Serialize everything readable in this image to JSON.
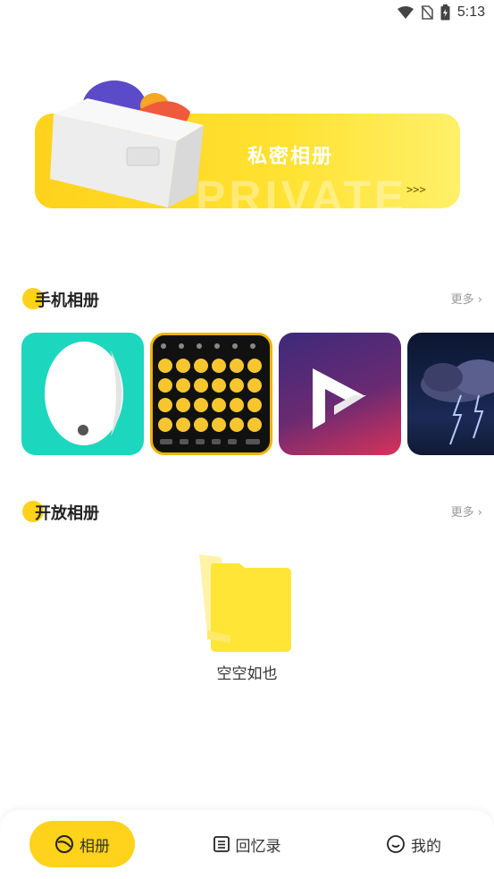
{
  "status_bar": {
    "time": "5:13"
  },
  "banner": {
    "title": "私密相册",
    "watermark": "PRIVATE",
    "arrows": ">>>"
  },
  "phone_albums": {
    "title": "手机相册",
    "more": "更多"
  },
  "open_albums": {
    "title": "开放相册",
    "more": "更多",
    "empty_text": "空空如也"
  },
  "bottom_nav": {
    "items": [
      {
        "label": "相册",
        "icon": "album-icon",
        "active": true
      },
      {
        "label": "回忆录",
        "icon": "list-icon",
        "active": false
      },
      {
        "label": "我的",
        "icon": "smile-icon",
        "active": false
      }
    ]
  },
  "colors": {
    "accent": "#ffd21c",
    "teal": "#1dd6be",
    "text": "#222222",
    "muted": "#999999"
  }
}
